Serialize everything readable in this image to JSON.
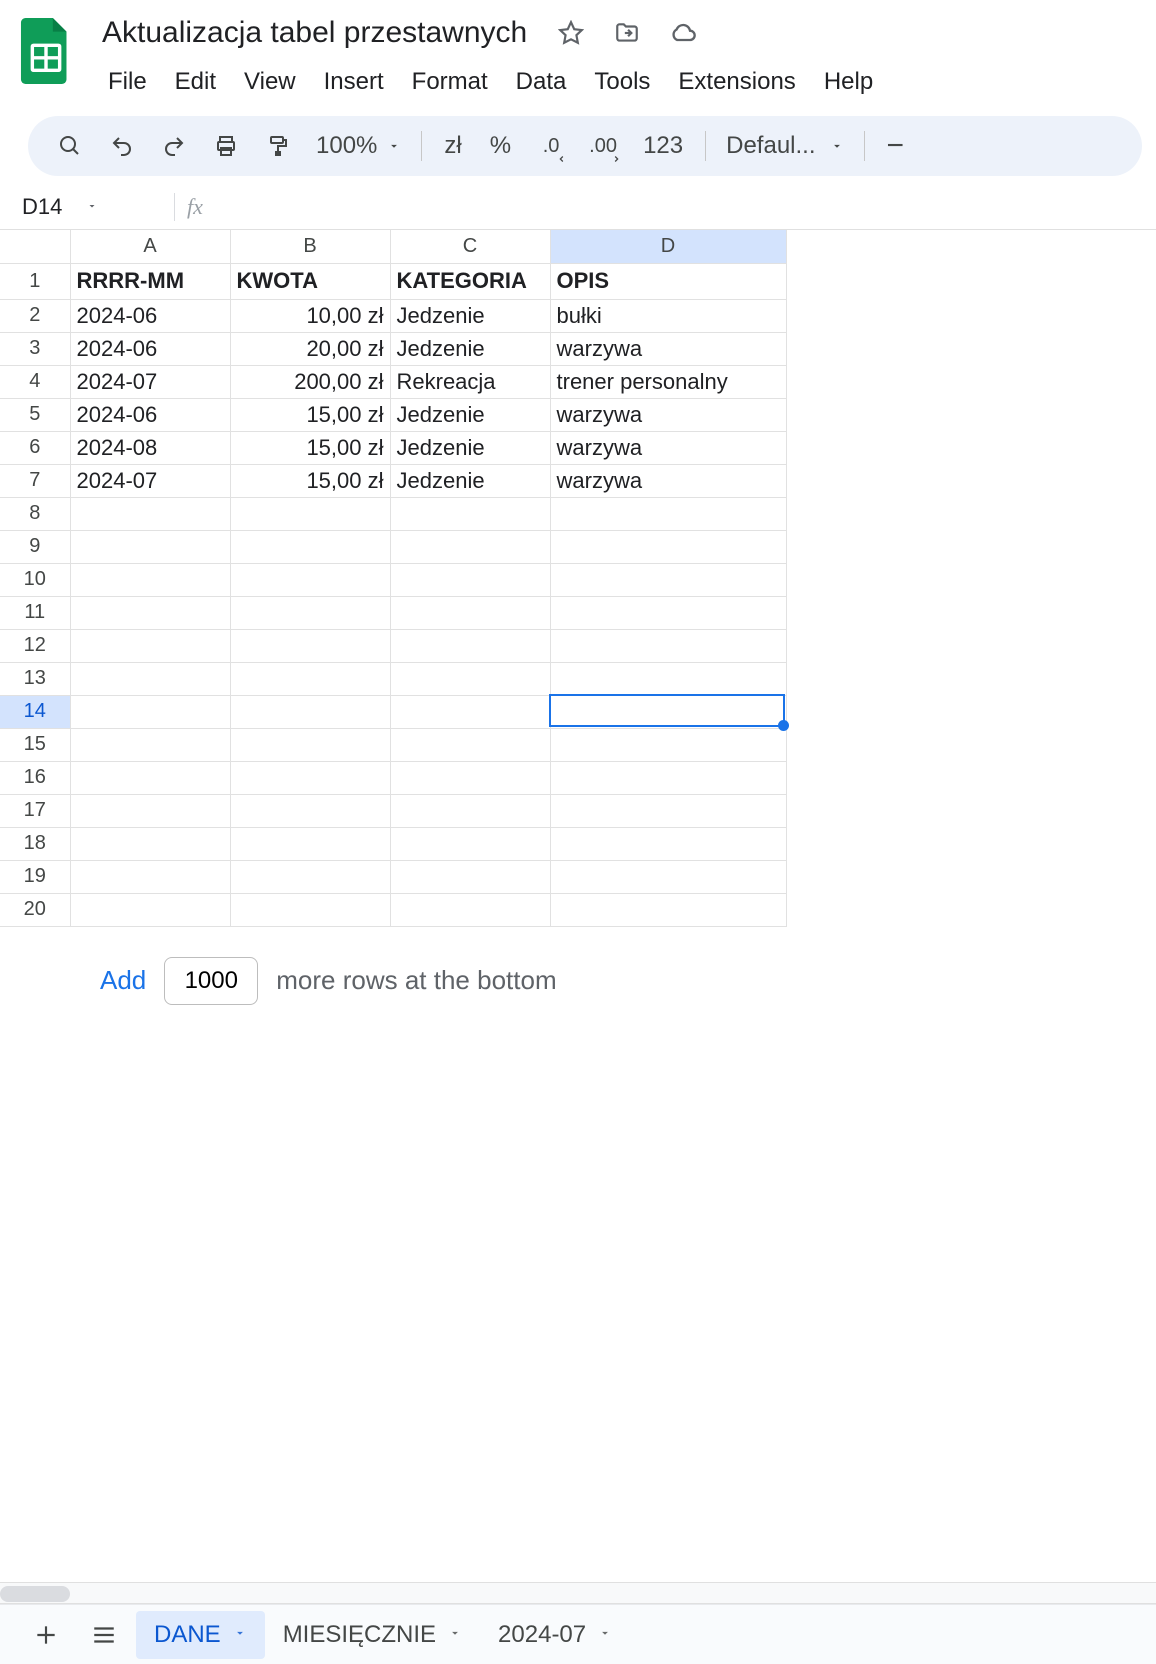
{
  "doc": {
    "title": "Aktualizacja tabel przestawnych"
  },
  "menu": {
    "file": "File",
    "edit": "Edit",
    "view": "View",
    "insert": "Insert",
    "format": "Format",
    "data": "Data",
    "tools": "Tools",
    "extensions": "Extensions",
    "help": "Help"
  },
  "toolbar": {
    "zoom": "100%",
    "currency": "zł",
    "percent": "%",
    "dec_dec": ".0",
    "inc_dec": ".00",
    "numfmt": "123",
    "font": "Defaul...",
    "minus": "−"
  },
  "namebox": "D14",
  "formula": "",
  "columns": [
    "A",
    "B",
    "C",
    "D"
  ],
  "selected": {
    "row": 14,
    "col": "D"
  },
  "table": {
    "headers": {
      "A": "RRRR-MM",
      "B": "KWOTA",
      "C": "KATEGORIA",
      "D": "OPIS"
    },
    "rows": [
      {
        "A": "2024-06",
        "B": "10,00 zł",
        "C": "Jedzenie",
        "D": "bułki"
      },
      {
        "A": "2024-06",
        "B": "20,00 zł",
        "C": "Jedzenie",
        "D": "warzywa"
      },
      {
        "A": "2024-07",
        "B": "200,00 zł",
        "C": "Rekreacja",
        "D": "trener personalny"
      },
      {
        "A": "2024-06",
        "B": "15,00 zł",
        "C": "Jedzenie",
        "D": "warzywa"
      },
      {
        "A": "2024-08",
        "B": "15,00 zł",
        "C": "Jedzenie",
        "D": "warzywa"
      },
      {
        "A": "2024-07",
        "B": "15,00 zł",
        "C": "Jedzenie",
        "D": "warzywa"
      }
    ],
    "total_rows": 20
  },
  "addrows": {
    "button": "Add",
    "count": "1000",
    "suffix": "more rows at the bottom"
  },
  "sheets": [
    {
      "name": "DANE",
      "active": true
    },
    {
      "name": "MIESIĘCZNIE",
      "active": false
    },
    {
      "name": "2024-07",
      "active": false
    }
  ]
}
